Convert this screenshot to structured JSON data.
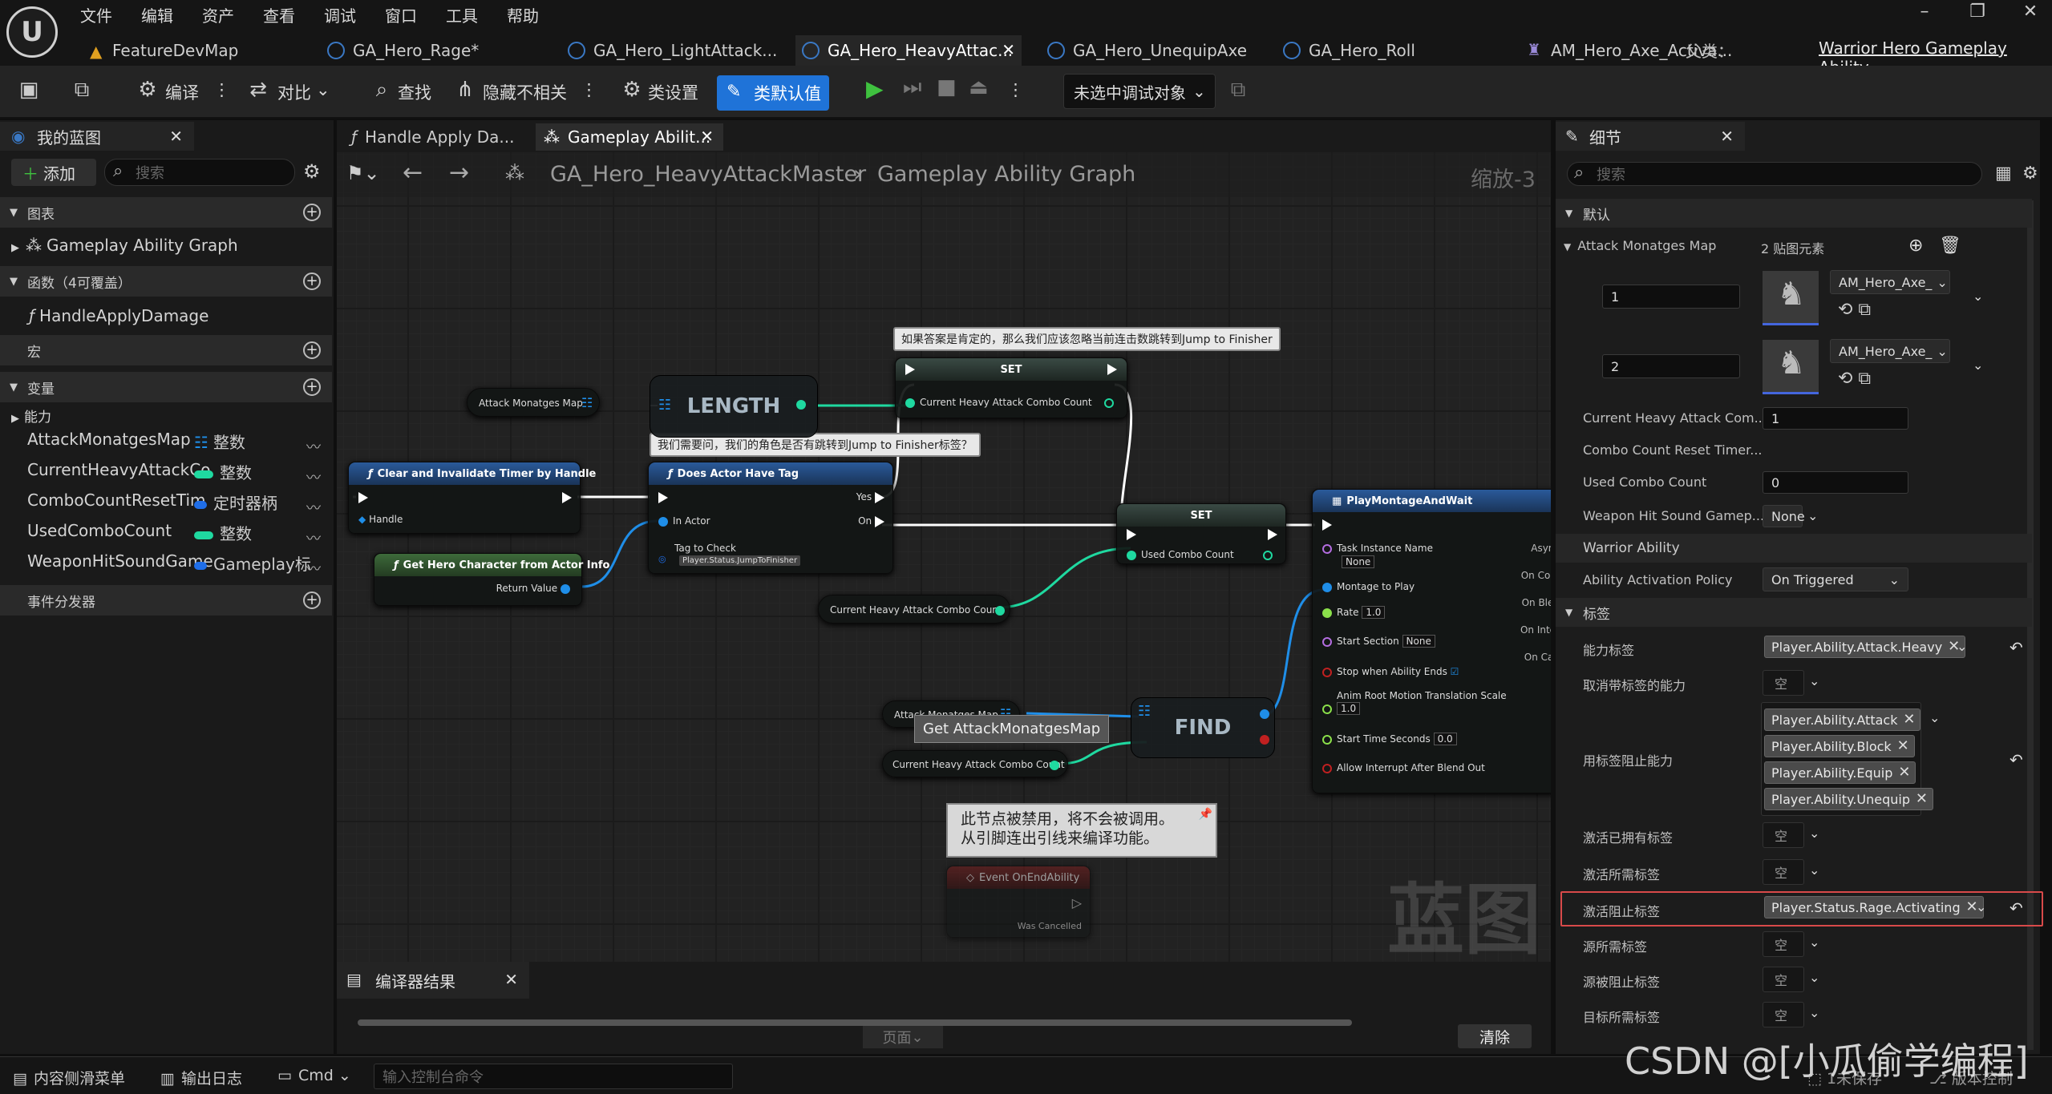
{
  "menu": [
    "文件",
    "编辑",
    "资产",
    "查看",
    "调试",
    "窗口",
    "工具",
    "帮助"
  ],
  "tabs": [
    {
      "label": "FeatureDevMap"
    },
    {
      "label": "GA_Hero_Rage*"
    },
    {
      "label": "GA_Hero_LightAttack..."
    },
    {
      "label": "GA_Hero_HeavyAttac..."
    },
    {
      "label": "GA_Hero_UnequipAxe"
    },
    {
      "label": "GA_Hero_Roll"
    },
    {
      "label": "AM_Hero_Axe_Activa..."
    }
  ],
  "parent": {
    "label": "父类：",
    "value": "Warrior Hero Gameplay Ability"
  },
  "toolbar": {
    "compile": "编译",
    "diff": "对比",
    "find": "查找",
    "hide": "隐藏不相关",
    "class_settings": "类设置",
    "class_defaults": "类默认值",
    "debug_select": "未选中调试对象"
  },
  "left": {
    "tab": "我的蓝图",
    "add": "添加",
    "search_placeholder": "搜索",
    "graphs": "图表",
    "graph_item": "Gameplay Ability Graph",
    "functions": "函数（4可覆盖）",
    "function_item": "HandleApplyDamage",
    "macros": "宏",
    "variables": "变量",
    "category": "能力",
    "vars": [
      {
        "name": "AttackMonatgesMap",
        "type": "整数",
        "color": "#1f8ee8"
      },
      {
        "name": "CurrentHeavyAttackCo",
        "type": "整数",
        "color": "#1fd9a0"
      },
      {
        "name": "ComboCountResetTim",
        "type": "定时器柄",
        "color": "#1f6ee8"
      },
      {
        "name": "UsedComboCount",
        "type": "整数",
        "color": "#1fd9a0"
      },
      {
        "name": "WeaponHitSoundGame",
        "type": "Gameplay标",
        "color": "#1f6ee8"
      }
    ],
    "dispatchers": "事件分发器"
  },
  "graph": {
    "tabs": [
      "Handle Apply Da...",
      "Gameplay Abilit..."
    ],
    "breadcrumb1": "GA_Hero_HeavyAttackMaster",
    "breadcrumb2": "Gameplay Ability Graph",
    "zoom": "缩放-3",
    "watermark": "蓝图",
    "comment1": "如果答案是肯定的，那么我们应该忽略当前连击数跳转到Jump to Finisher",
    "comment2": "我们需要问，我们的角色是否有跳转到Jump to Finisher标签？",
    "comment3a": "此节点被禁用，将不会被调用。",
    "comment3b": "从引脚连出引线来编译功能。",
    "tooltip": "Get AttackMonatgesMap",
    "n_attackmap": "Attack Monatges Map",
    "n_length": "LENGTH",
    "n_set": "SET",
    "n_set_pin": "Current Heavy Attack Combo Count",
    "n_clear": "Clear and Invalidate Timer by Handle",
    "n_handle": "Handle",
    "n_has_tag": "Does Actor Have Tag",
    "n_in_actor": "In Actor",
    "n_tag_check": "Tag to Check",
    "n_tag_val": "Player.Status.JumpToFinisher",
    "n_yes": "Yes",
    "n_on": "On",
    "n_get_hero": "Get Hero Character from Actor Info",
    "n_return": "Return Value",
    "n_current": "Current Heavy Attack Combo Count",
    "n_set2_pin": "Used Combo Count",
    "n_play": "PlayMontageAndWait",
    "n_task": "Task Instance Name",
    "n_none": "None",
    "n_montage": "Montage to Play",
    "n_rate": "Rate",
    "n_rate_v": "1.0",
    "n_section": "Start Section",
    "n_stop": "Stop when Ability Ends",
    "n_anim": "Anim Root Motion Translation Scale",
    "n_anim_v": "1.0",
    "n_start_time": "Start Time Seconds",
    "n_start_v": "0.0",
    "n_allow": "Allow Interrupt After Blend Out",
    "n_async": "Async",
    "n_oncomp": "On Com",
    "n_onblen": "On Blen",
    "n_oninter": "On Inter",
    "n_oncan": "On Can",
    "n_find": "FIND",
    "n_attackmap2": "Attack Monatges Map",
    "n_current2": "Current Heavy Attack Combo Count",
    "n_event": "Event OnEndAbility",
    "n_cancelled": "Was Cancelled"
  },
  "compiler": {
    "title": "编译器结果",
    "page": "页面",
    "clear": "清除"
  },
  "details": {
    "tab": "细节",
    "search_placeholder": "搜索",
    "default": "默认",
    "attack_map": "Attack Monatges Map",
    "elements": "2 贴图元素",
    "entries": [
      {
        "key": "1",
        "value": "AM_Hero_Axe_"
      },
      {
        "key": "2",
        "value": "AM_Hero_Axe_"
      }
    ],
    "rows": [
      {
        "label": "Current Heavy Attack Com...",
        "value": "1"
      },
      {
        "label": "Combo Count Reset Timer...",
        "value": ""
      },
      {
        "label": "Used Combo Count",
        "value": "0"
      },
      {
        "label": "Weapon Hit Sound Gamep...",
        "value": "None"
      }
    ],
    "warrior": "Warrior Ability",
    "activation_policy": "Ability Activation Policy",
    "activation_value": "On Triggered",
    "tags": "标签",
    "ability_tags": "能力标签",
    "ability_tag_v": "Player.Ability.Attack.Heavy",
    "cancel": "取消带标签的能力",
    "empty": "空",
    "block": "用标签阻止能力",
    "block_tags": [
      "Player.Ability.Attack",
      "Player.Ability.Block",
      "Player.Ability.Equip",
      "Player.Ability.Unequip"
    ],
    "owned": "激活已拥有标签",
    "required": "激活所需标签",
    "blocked": "激活阻止标签",
    "blocked_v": "Player.Status.Rage.Activating",
    "source_req": "源所需标签",
    "source_block": "源被阻止标签",
    "target_req": "目标所需标签"
  },
  "status": {
    "content": "内容侧滑菜单",
    "output": "输出日志",
    "cmd": "Cmd",
    "console_placeholder": "输入控制台命令",
    "unsaved": "1未保存",
    "version": "版本控制"
  },
  "watermark": "CSDN @[小瓜偷学编程]"
}
